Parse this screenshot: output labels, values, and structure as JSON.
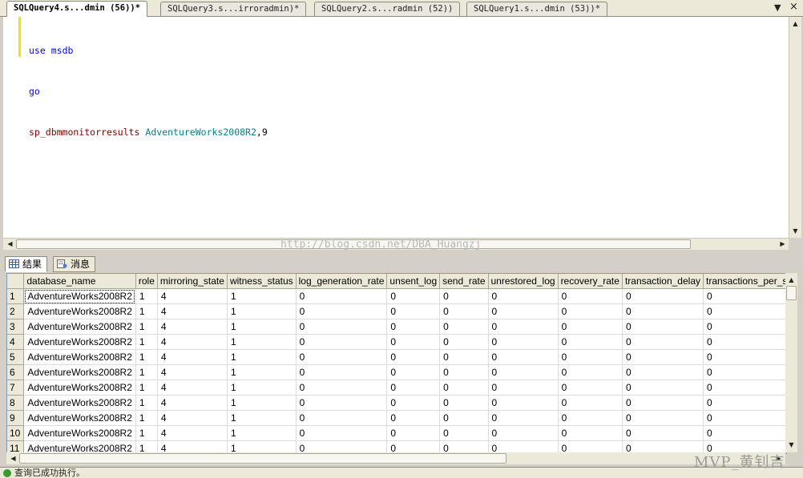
{
  "tabs": [
    {
      "label": "SQLQuery4.s...dmin (56))*",
      "active": true
    },
    {
      "label": "SQLQuery3.s...irroradmin)*",
      "active": false
    },
    {
      "label": "SQLQuery2.s...radmin (52))",
      "active": false
    },
    {
      "label": "SQLQuery1.s...dmin (53))*",
      "active": false
    }
  ],
  "tab_controls": {
    "dropdown": "▼",
    "close": "×"
  },
  "editor": {
    "line1": {
      "kw": "use",
      "db": "msdb"
    },
    "line2": {
      "kw": "go"
    },
    "line3": {
      "proc": "sp_dbmmonitorresults",
      "arg": "AdventureWorks2008R2",
      "num": ",9"
    }
  },
  "watermark": "http://blog.csdn.net/DBA_Huangzj",
  "results_tabs": {
    "results": "结果",
    "messages": "消息"
  },
  "grid": {
    "columns": [
      "database_name",
      "role",
      "mirroring_state",
      "witness_status",
      "log_generation_rate",
      "unsent_log",
      "send_rate",
      "unrestored_log",
      "recovery_rate",
      "transaction_delay",
      "transactions_per_se"
    ],
    "rows": [
      [
        "1",
        "AdventureWorks2008R2",
        "1",
        "4",
        "1",
        "0",
        "0",
        "0",
        "0",
        "0",
        "0",
        "0"
      ],
      [
        "2",
        "AdventureWorks2008R2",
        "1",
        "4",
        "1",
        "0",
        "0",
        "0",
        "0",
        "0",
        "0",
        "0"
      ],
      [
        "3",
        "AdventureWorks2008R2",
        "1",
        "4",
        "1",
        "0",
        "0",
        "0",
        "0",
        "0",
        "0",
        "0"
      ],
      [
        "4",
        "AdventureWorks2008R2",
        "1",
        "4",
        "1",
        "0",
        "0",
        "0",
        "0",
        "0",
        "0",
        "0"
      ],
      [
        "5",
        "AdventureWorks2008R2",
        "1",
        "4",
        "1",
        "0",
        "0",
        "0",
        "0",
        "0",
        "0",
        "0"
      ],
      [
        "6",
        "AdventureWorks2008R2",
        "1",
        "4",
        "1",
        "0",
        "0",
        "0",
        "0",
        "0",
        "0",
        "0"
      ],
      [
        "7",
        "AdventureWorks2008R2",
        "1",
        "4",
        "1",
        "0",
        "0",
        "0",
        "0",
        "0",
        "0",
        "0"
      ],
      [
        "8",
        "AdventureWorks2008R2",
        "1",
        "4",
        "1",
        "0",
        "0",
        "0",
        "0",
        "0",
        "0",
        "0"
      ],
      [
        "9",
        "AdventureWorks2008R2",
        "1",
        "4",
        "1",
        "0",
        "0",
        "0",
        "0",
        "0",
        "0",
        "0"
      ],
      [
        "10",
        "AdventureWorks2008R2",
        "1",
        "4",
        "1",
        "0",
        "0",
        "0",
        "0",
        "0",
        "0",
        "0"
      ],
      [
        "11",
        "AdventureWorks2008R2",
        "1",
        "4",
        "1",
        "0",
        "0",
        "0",
        "0",
        "0",
        "0",
        "0"
      ]
    ]
  },
  "status": {
    "text": "查询已成功执行。"
  },
  "signature": "MVP_黄钊吉"
}
